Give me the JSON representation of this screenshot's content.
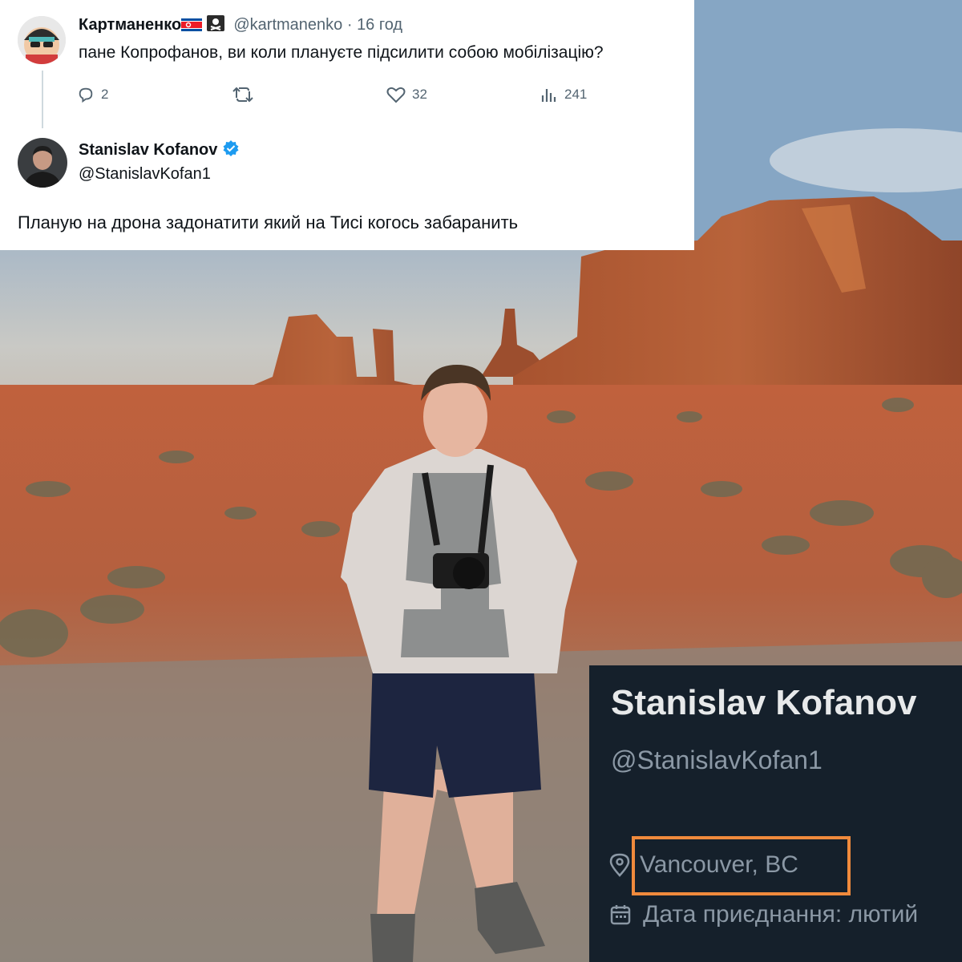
{
  "colors": {
    "accent": "#1d9bf0",
    "highlight": "#f08a3c",
    "card_bg": "#15202b"
  },
  "tweet": {
    "author_name": "Картманенко",
    "author_handle": "@kartmanenko",
    "time": "16 год",
    "text": "пане Копрофанов, ви коли плануєте підсилити собою мобілізацію?",
    "stats": {
      "replies": "2",
      "likes": "32",
      "views": "241"
    },
    "icons": [
      "reply-icon",
      "retweet-icon",
      "like-icon",
      "views-icon"
    ]
  },
  "reply": {
    "author_name": "Stanislav Kofanov",
    "author_handle": "@StanislavKofan1",
    "text": "Планую на дрона задонатити який на Тисі когось забаранить",
    "icons": [
      "verified-badge-icon"
    ]
  },
  "profile": {
    "name": "Stanislav Kofanov",
    "handle": "@StanislavKofan1",
    "location": "Vancouver, BC",
    "joined": "Дата приєднання: лютий",
    "icons": [
      "location-pin-icon",
      "calendar-icon"
    ]
  }
}
